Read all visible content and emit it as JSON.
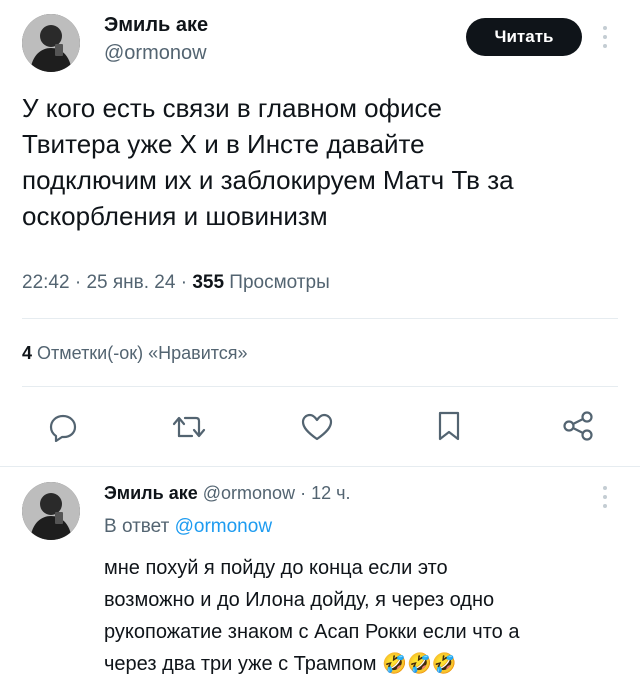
{
  "tweet": {
    "author_name": "Эмиль аке",
    "author_handle": "@ormonow",
    "follow_label": "Читать",
    "more_icon": "more-vertical-icon",
    "text_lines": [
      "У кого есть связи в главном офисе",
      "Твитера уже Х  и в Инсте давайте",
      "подключим их и заблокируем Матч Тв за",
      "оскорбления и шовинизм"
    ],
    "time": "22:42",
    "date": "25 янв. 24",
    "views_count": "355",
    "views_label": "Просмотры",
    "likes_count": "4",
    "likes_label": "Отметки(-ок) «Нравится»"
  },
  "actions": [
    {
      "name": "reply",
      "icon": "reply-icon"
    },
    {
      "name": "retweet",
      "icon": "retweet-icon"
    },
    {
      "name": "like",
      "icon": "heart-icon"
    },
    {
      "name": "bookmark",
      "icon": "bookmark-icon"
    },
    {
      "name": "share",
      "icon": "share-icon"
    }
  ],
  "reply": {
    "author_name": "Эмиль аке",
    "author_handle": "@ormonow",
    "separator": "·",
    "age": "12 ч.",
    "in_reply_label": "В ответ",
    "in_reply_handle": "@ormonow",
    "text_lines": [
      "мне похуй я пойду до конца если это",
      "возможно и до Илона дойду, я через одно",
      "рукопожатие знаком с Асап Рокки если что а",
      "через два три уже с Трампом"
    ],
    "emoji": "🤣🤣🤣"
  },
  "colors": {
    "text": "#0f1419",
    "secondary": "#536471",
    "link": "#1d9bf0",
    "button_bg": "#0f1419",
    "divider": "#e6ecf0"
  }
}
